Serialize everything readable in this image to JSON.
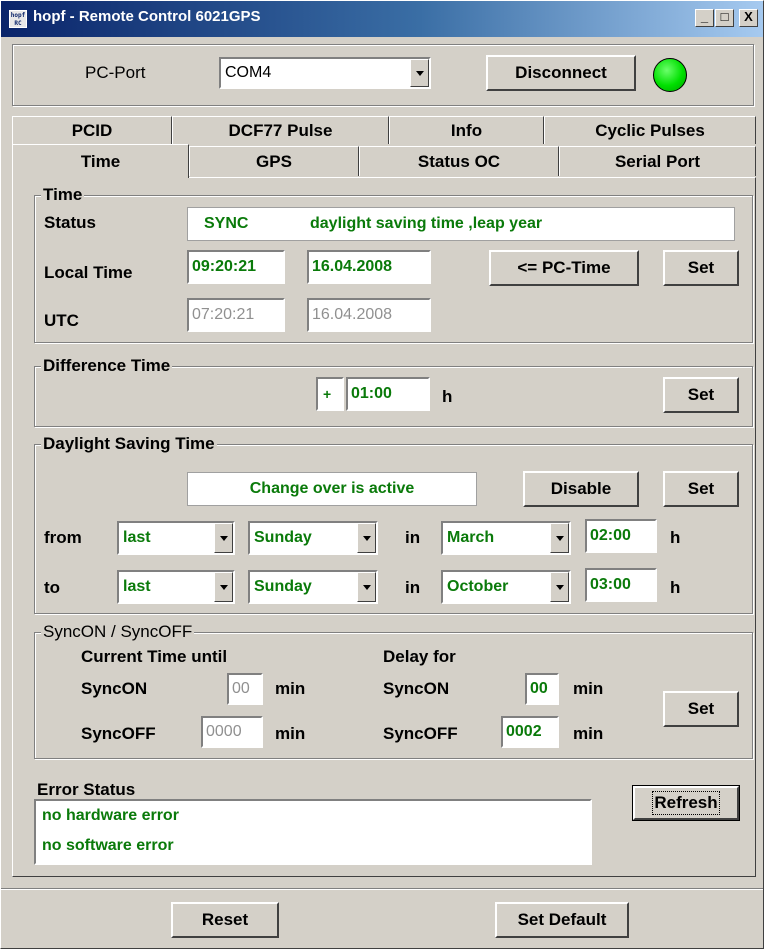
{
  "window": {
    "title": "hopf - Remote Control 6021GPS",
    "icon_text": "hopf RC",
    "minimize": "_",
    "maximize": "□",
    "close": "X"
  },
  "connection": {
    "port_label": "PC-Port",
    "port_value": "COM4",
    "disconnect_label": "Disconnect",
    "led_color": "#00e000"
  },
  "tabs": {
    "row1": [
      "PCID",
      "DCF77 Pulse",
      "Info",
      "Cyclic Pulses"
    ],
    "row2": [
      "Time",
      "GPS",
      "Status OC",
      "Serial Port"
    ],
    "active": "Time"
  },
  "time_group": {
    "title": "Time",
    "status_label": "Status",
    "status_value": "SYNC",
    "status_detail": "daylight saving time ,leap year",
    "local_label": "Local Time",
    "local_time": "09:20:21",
    "local_date": "16.04.2008",
    "pc_time_label": "<= PC-Time",
    "set_label": "Set",
    "utc_label": "UTC",
    "utc_time": "07:20:21",
    "utc_date": "16.04.2008"
  },
  "difference_group": {
    "title": "Difference Time",
    "sign": "+",
    "value": "01:00",
    "unit": "h",
    "set_label": "Set"
  },
  "dst_group": {
    "title": "Daylight Saving Time",
    "status": "Change over is active",
    "disable_label": "Disable",
    "set_label": "Set",
    "from_label": "from",
    "to_label": "to",
    "in_label": "in",
    "unit": "h",
    "from": {
      "week": "last",
      "day": "Sunday",
      "month": "March",
      "time": "02:00"
    },
    "to": {
      "week": "last",
      "day": "Sunday",
      "month": "October",
      "time": "03:00"
    }
  },
  "sync_group": {
    "title": "SyncON / SyncOFF",
    "current_header": "Current Time until",
    "delay_header": "Delay for",
    "synon_label": "SyncON",
    "syncoff_label": "SyncOFF",
    "min_label": "min",
    "current_syncon": "00",
    "current_syncoff": "0000",
    "delay_syncon": "00",
    "delay_syncoff": "0002",
    "set_label": "Set"
  },
  "error_group": {
    "title": "Error Status",
    "lines": [
      "no hardware error",
      "no software error"
    ],
    "refresh_label": "Refresh"
  },
  "footer": {
    "reset_label": "Reset",
    "default_label": "Set Default"
  }
}
